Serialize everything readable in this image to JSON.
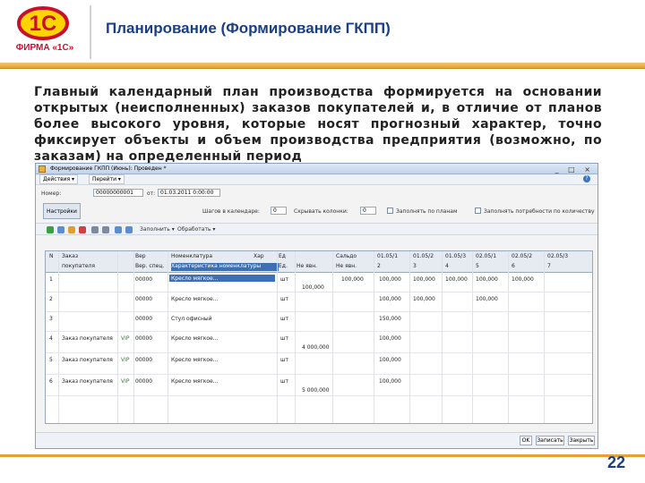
{
  "header": {
    "title": "Планирование (Формирование ГКПП)",
    "logo_text": "ФИРМА «1С»",
    "logo_mark": "1С"
  },
  "paragraph": "Главный календарный план производства формируется на основании открытых (неисполненных) заказов покупателей и, в отличие от планов более высокого уровня, которые носят прогнозный характер, точно фиксирует объекты и объем производства предприятия (возможно, по заказам) на определенный период",
  "window": {
    "title": "Формирование ГКПП (Июнь): Проведен *",
    "controls": "_ □ ×",
    "toolbar": [
      "Действия ▾",
      "Перейти ▾"
    ],
    "number_label": "Номер:",
    "number_value": "00000000001",
    "date_label": "от:",
    "date_value": "01.03.2011 0:00:00",
    "settings_tab": "Настройки",
    "show_columns_label": "Шагов в календаре:",
    "show_columns_value": "0",
    "hide_columns_label": "Скрывать колонки:",
    "hide_columns_value": "0",
    "chk1_label": "Заполнять по планам",
    "chk2_label": "Заполнять потребности по количеству",
    "fill_button": "Заполнить ▾",
    "process_button": "Обработать ▾",
    "grid": {
      "headers_top": [
        "N",
        "Заказ",
        "Вер",
        "Номенклатура",
        "Хар",
        "Ед",
        "Сальдо",
        "01.05/1",
        "01.05/2",
        "01.05/3",
        "02.05/1",
        "02.05/2",
        "02.05/3"
      ],
      "headers_bottom": [
        "",
        "покупателя",
        "Вер. спец.",
        "Характеристика номенклатуры",
        "Ед.",
        "Не явн.",
        "Не явн.",
        "2",
        "3",
        "4",
        "5",
        "6",
        "7"
      ],
      "rows": [
        {
          "n": "1",
          "order": "",
          "v": "",
          "code": "00000",
          "name": "Кресло мягкое...",
          "unit": "шт",
          "c1": "100,000",
          "c2": "100,000",
          "c3": "100,000",
          "c4": "100,000",
          "c5": "100,000",
          "c6": "100,000",
          "extra": "100,000"
        },
        {
          "n": "2",
          "order": "",
          "v": "",
          "code": "00000",
          "name": "Кресло мягкое...",
          "unit": "шт",
          "c1": "",
          "c2": "100,000",
          "c3": "100,000",
          "c4": "",
          "c5": "100,000",
          "c6": "",
          "extra": ""
        },
        {
          "n": "3",
          "order": "",
          "v": "",
          "code": "00000",
          "name": "Стул офисный",
          "unit": "шт",
          "c1": "",
          "c2": "150,000",
          "c3": "",
          "c4": "",
          "c5": "",
          "c6": "",
          "extra": ""
        },
        {
          "n": "4",
          "order": "Заказ покупателя",
          "v": "VIP",
          "code": "00000",
          "name": "Кресло мягкое...",
          "unit": "шт",
          "c1": "",
          "c2": "100,000",
          "c3": "",
          "c4": "",
          "c5": "",
          "c6": "",
          "extra": "4 000,000"
        },
        {
          "n": "5",
          "order": "Заказ покупателя",
          "v": "VIP",
          "code": "00000",
          "name": "Кресло мягкое...",
          "unit": "шт",
          "c1": "",
          "c2": "100,000",
          "c3": "",
          "c4": "",
          "c5": "",
          "c6": "",
          "extra": ""
        },
        {
          "n": "6",
          "order": "Заказ покупателя",
          "v": "VIP",
          "code": "00000",
          "name": "Кресло мягкое...",
          "unit": "шт",
          "c1": "",
          "c2": "100,000",
          "c3": "",
          "c4": "",
          "c5": "",
          "c6": "",
          "extra": "5 000,000"
        }
      ]
    },
    "bottom_buttons": [
      "OK",
      "Записать",
      "Закрыть"
    ]
  },
  "page_number": "22",
  "colors": {
    "title": "#1b3f83",
    "accent": "#e8a030",
    "logo_red": "#c8102e"
  }
}
